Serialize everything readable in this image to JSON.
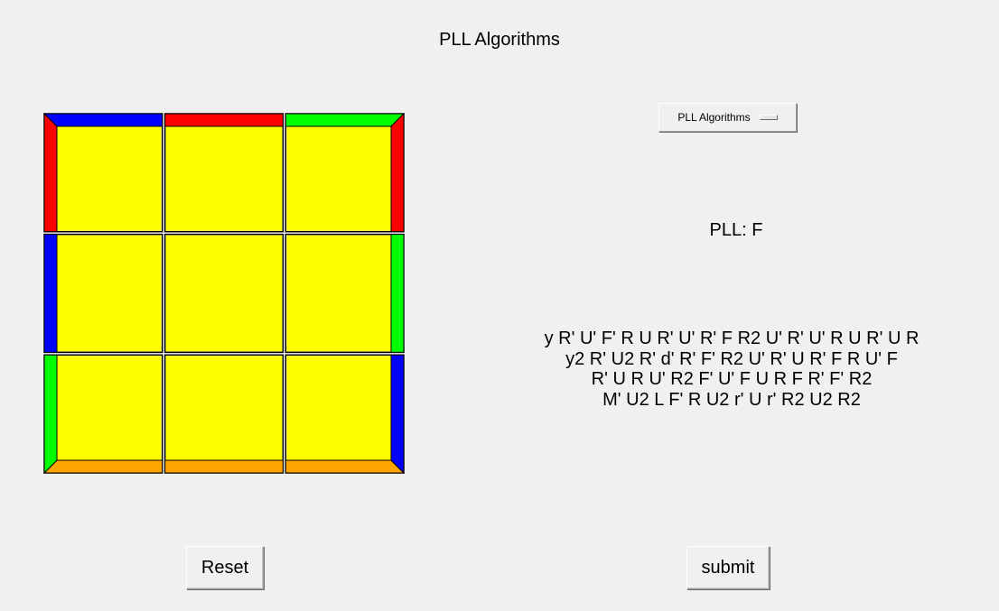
{
  "window": {
    "title": "PLL Algorithms"
  },
  "cube": {
    "top_face_color": "#ffff00",
    "edge_stickers": {
      "back": [
        "#0000ff",
        "#ff0000",
        "#00ff00"
      ],
      "left": [
        "#ff0000",
        "#0000ff",
        "#00ff00"
      ],
      "right": [
        "#ff0000",
        "#00ff00",
        "#0000ff"
      ],
      "front": [
        "#ffa500",
        "#ffa500",
        "#ffa500"
      ]
    }
  },
  "menu": {
    "selected": "PLL Algorithms"
  },
  "case": {
    "label": "PLL: F"
  },
  "algorithms": [
    "y R' U' F' R U R' U' R' F R2 U' R' U' R U R' U R",
    "y2 R' U2 R' d' R' F' R2 U' R' U R' F R U' F",
    "R' U R U' R2 F' U' F U R F R' F' R2",
    "M' U2 L F' R U2 r' U r' R2 U2 R2"
  ],
  "buttons": {
    "reset": "Reset",
    "submit": "submit"
  }
}
